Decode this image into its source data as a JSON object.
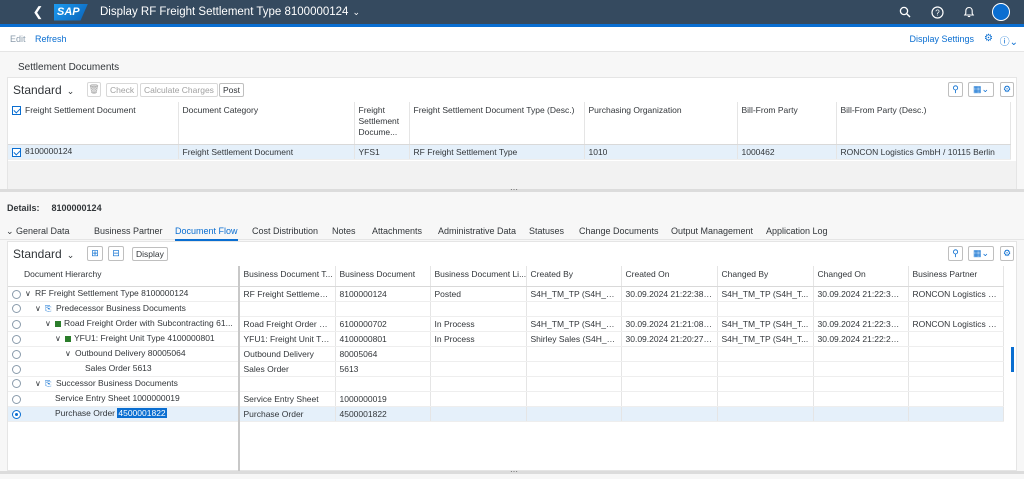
{
  "shell": {
    "logo": "SAP",
    "title": "Display RF Freight Settlement Type 8100000124",
    "icons": [
      "search-icon",
      "help-icon",
      "bell-icon",
      "avatar"
    ]
  },
  "toolbar": {
    "edit": "Edit",
    "refresh": "Refresh",
    "display_settings": "Display Settings"
  },
  "settlement": {
    "section_title": "Settlement Documents",
    "variant": "Standard",
    "buttons": {
      "check": "Check",
      "calc": "Calculate Charges",
      "post": "Post"
    },
    "columns": [
      "Freight Settlement Document",
      "Document Category",
      "Freight Settlement Docume...",
      "Freight Settlement Document Type (Desc.)",
      "Purchasing Organization",
      "Bill-From Party",
      "Bill-From Party (Desc.)"
    ],
    "rows": [
      [
        "8100000124",
        "Freight Settlement Document",
        "YFS1",
        "RF Freight Settlement Type",
        "1010",
        "1000462",
        "RONCON Logistics GmbH / 10115 Berlin"
      ]
    ]
  },
  "details": {
    "label": "Details:",
    "id": "8100000124",
    "tabs": [
      "General Data",
      "Business Partner",
      "Document Flow",
      "Cost Distribution",
      "Notes",
      "Attachments",
      "Administrative Data",
      "Statuses",
      "Change Documents",
      "Output Management",
      "Application Log"
    ],
    "active_tab": "Document Flow"
  },
  "flow": {
    "variant": "Standard",
    "display_btn": "Display",
    "columns": [
      "Document Hierarchy",
      "Business Document T...",
      "Business Document",
      "Business Document Li...",
      "Created By",
      "Created On",
      "Changed By",
      "Changed On",
      "Business Partner"
    ],
    "rows": [
      {
        "level": 0,
        "arrow": "v",
        "icon": "",
        "hier": "RF Freight Settlement Type 8100000124",
        "type": "RF Freight Settlement ...",
        "doc": "8100000124",
        "status": "Posted",
        "created_by": "S4H_TM_TP (S4H_T...",
        "created_on": "30.09.2024 21:22:38 ...",
        "changed_by": "S4H_TM_TP (S4H_T...",
        "changed_on": "30.09.2024 21:22:39 ...",
        "bp": "RONCON Logistics G..."
      },
      {
        "level": 1,
        "arrow": "v",
        "icon": "doc",
        "hier": "Predecessor Business Documents",
        "type": "",
        "doc": "",
        "status": "",
        "created_by": "",
        "created_on": "",
        "changed_by": "",
        "changed_on": "",
        "bp": ""
      },
      {
        "level": 2,
        "arrow": "v",
        "icon": "green",
        "hier": "Road Freight Order with Subcontracting 61...",
        "type": "Road Freight Order wit...",
        "doc": "6100000702",
        "status": "In Process",
        "created_by": "S4H_TM_TP (S4H_T...",
        "created_on": "30.09.2024 21:21:08 ...",
        "changed_by": "S4H_TM_TP (S4H_T...",
        "changed_on": "30.09.2024 21:22:38 ...",
        "bp": "RONCON Logistics G..."
      },
      {
        "level": 3,
        "arrow": "v",
        "icon": "green",
        "hier": "YFU1: Freight Unit Type 4100000801",
        "type": "YFU1: Freight Unit Type",
        "doc": "4100000801",
        "status": "In Process",
        "created_by": "Shirley Sales (S4H_S...",
        "created_on": "30.09.2024 21:20:27 ...",
        "changed_by": "S4H_TM_TP (S4H_T...",
        "changed_on": "30.09.2024 21:22:24 ...",
        "bp": ""
      },
      {
        "level": 4,
        "arrow": "v",
        "icon": "",
        "hier": "Outbound Delivery 80005064",
        "type": "Outbound Delivery",
        "doc": "80005064",
        "status": "",
        "created_by": "",
        "created_on": "",
        "changed_by": "",
        "changed_on": "",
        "bp": ""
      },
      {
        "level": 5,
        "arrow": "",
        "icon": "",
        "hier": "Sales Order 5613",
        "type": "Sales Order",
        "doc": "5613",
        "status": "",
        "created_by": "",
        "created_on": "",
        "changed_by": "",
        "changed_on": "",
        "bp": ""
      },
      {
        "level": 1,
        "arrow": "v",
        "icon": "doc",
        "hier": "Successor Business Documents",
        "type": "",
        "doc": "",
        "status": "",
        "created_by": "",
        "created_on": "",
        "changed_by": "",
        "changed_on": "",
        "bp": ""
      },
      {
        "level": 2,
        "arrow": "",
        "icon": "",
        "hier": "Service Entry Sheet 1000000019",
        "type": "Service Entry Sheet",
        "doc": "1000000019",
        "status": "",
        "created_by": "",
        "created_on": "",
        "changed_by": "",
        "changed_on": "",
        "bp": ""
      },
      {
        "level": 2,
        "arrow": "",
        "icon": "",
        "hier": "Purchase Order ",
        "hier_sel": "4500001822",
        "type": "Purchase Order",
        "doc": "4500001822",
        "status": "",
        "created_by": "",
        "created_on": "",
        "changed_by": "",
        "changed_on": "",
        "bp": "",
        "selected": true
      }
    ]
  },
  "colors": {
    "shell": "#354a5f",
    "accent": "#0a6ed1",
    "green": "#2b7d2b"
  }
}
